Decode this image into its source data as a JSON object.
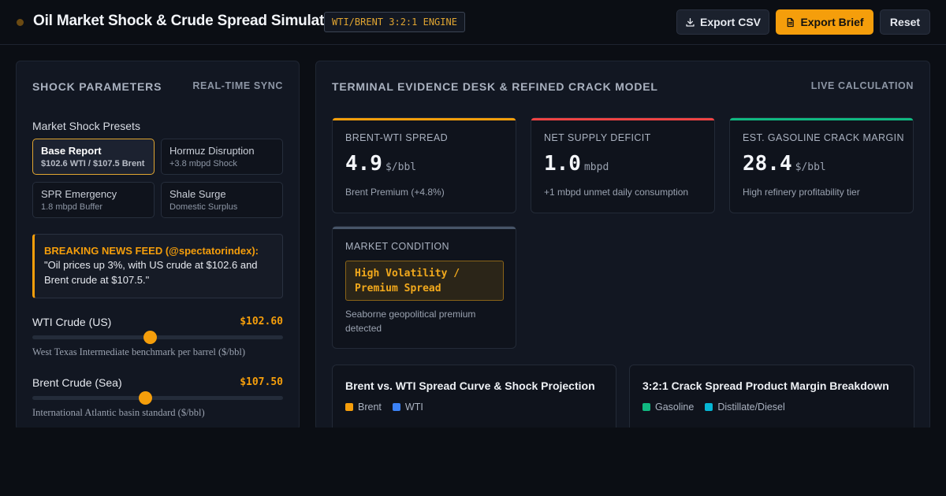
{
  "header": {
    "title": "Oil Market Shock & Crude Spread Simulator",
    "engine_badge": "WTI/BRENT 3:2:1 ENGINE",
    "export_csv_label": "Export CSV",
    "export_brief_label": "Export Brief",
    "reset_label": "Reset"
  },
  "left_panel": {
    "title": "SHOCK PARAMETERS",
    "tag": "REAL-TIME SYNC",
    "presets_label": "Market Shock Presets",
    "presets": [
      {
        "name": "Base Report",
        "sub": "$102.6 WTI / $107.5 Brent",
        "active": true
      },
      {
        "name": "Hormuz Disruption",
        "sub": "+3.8 mbpd Shock",
        "active": false
      },
      {
        "name": "SPR Emergency",
        "sub": "1.8 mbpd Buffer",
        "active": false
      },
      {
        "name": "Shale Surge",
        "sub": "Domestic Surplus",
        "active": false
      }
    ],
    "news": {
      "headline": "BREAKING NEWS FEED (@spectatorindex):",
      "body": "\"Oil prices up 3%, with US crude at $102.6 and Brent crude at $107.5.\""
    },
    "sliders": [
      {
        "label": "WTI Crude (US)",
        "value": "$102.60",
        "position": 0.47,
        "desc": "West Texas Intermediate benchmark per barrel ($/bbl)"
      },
      {
        "label": "Brent Crude (Sea)",
        "value": "$107.50",
        "position": 0.45,
        "desc": "International Atlantic basin standard ($/bbl)"
      }
    ]
  },
  "right_panel": {
    "title": "TERMINAL EVIDENCE DESK & REFINED CRACK MODEL",
    "tag": "LIVE CALCULATION",
    "cards": [
      {
        "label": "BRENT-WTI SPREAD",
        "value": "4.9",
        "unit": "$/bbl",
        "note": "Brent Premium (+4.8%)",
        "accent": "#f59e0b"
      },
      {
        "label": "NET SUPPLY DEFICIT",
        "value": "1.0",
        "unit": "mbpd",
        "note": "+1 mbpd unmet daily consumption",
        "accent": "#ef4444"
      },
      {
        "label": "EST. GASOLINE CRACK MARGIN",
        "value": "28.4",
        "unit": "$/bbl",
        "note": "High refinery profitability tier",
        "accent": "#10b981"
      }
    ],
    "condition": {
      "label": "MARKET CONDITION",
      "value": "High Volatility / Premium Spread",
      "note": "Seaborne geopolitical premium detected",
      "accent": "#475569"
    },
    "charts": [
      {
        "title": "Brent vs. WTI Spread Curve & Shock Projection",
        "legend": [
          {
            "name": "Brent",
            "color": "#f59e0b"
          },
          {
            "name": "WTI",
            "color": "#3b82f6"
          }
        ]
      },
      {
        "title": "3:2:1 Crack Spread Product Margin Breakdown",
        "legend": [
          {
            "name": "Gasoline",
            "color": "#10b981"
          },
          {
            "name": "Distillate/Diesel",
            "color": "#06b6d4"
          }
        ]
      }
    ]
  }
}
